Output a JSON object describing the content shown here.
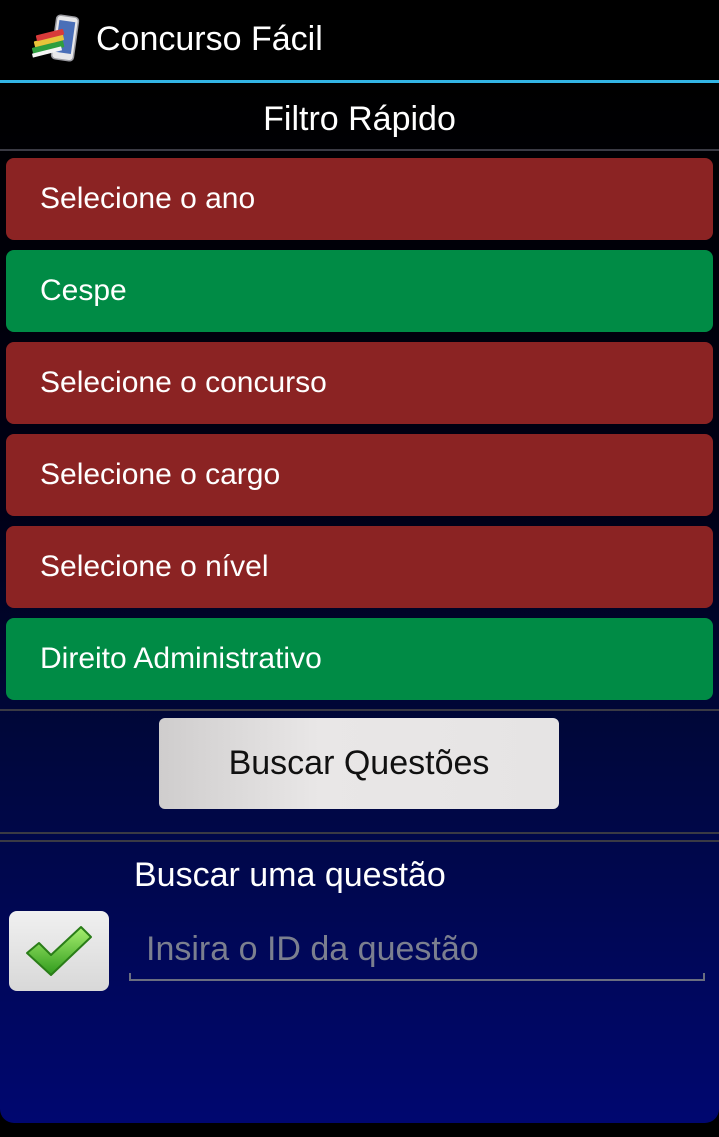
{
  "app": {
    "title": "Concurso Fácil",
    "icon": "books-phone-icon"
  },
  "filter": {
    "title": "Filtro Rápido",
    "items": [
      {
        "label": "Selecione o ano",
        "state": "unset",
        "color": "#8b2323"
      },
      {
        "label": "Cespe",
        "state": "set",
        "color": "#008b45"
      },
      {
        "label": "Selecione o concurso",
        "state": "unset",
        "color": "#8b2323"
      },
      {
        "label": "Selecione o cargo",
        "state": "unset",
        "color": "#8b2323"
      },
      {
        "label": "Selecione o nível",
        "state": "unset",
        "color": "#8b2323"
      },
      {
        "label": "Direito Administrativo",
        "state": "set",
        "color": "#008b45"
      }
    ],
    "search_button_label": "Buscar Questões"
  },
  "single_search": {
    "label": "Buscar uma questão",
    "confirm_icon": "checkmark-icon",
    "input_placeholder": "Insira o ID da questão",
    "input_value": ""
  },
  "colors": {
    "accent": "#33b5e5",
    "unset_item": "#8b2323",
    "set_item": "#008b45"
  }
}
